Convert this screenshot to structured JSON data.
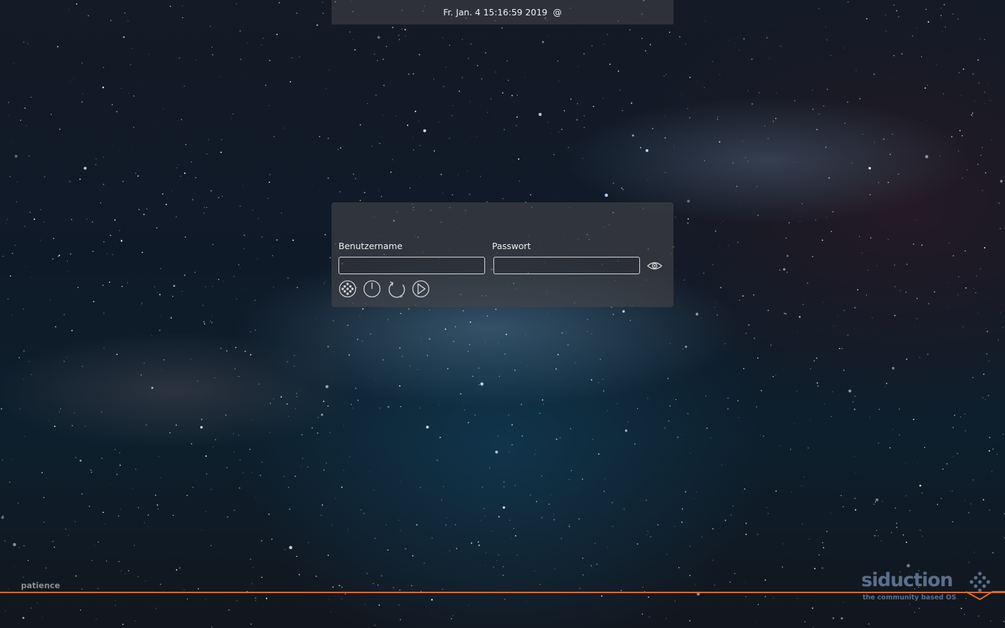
{
  "clock": {
    "datetime": "Fr. Jan. 4 15:16:59 2019",
    "host_suffix": "@"
  },
  "login": {
    "username_label": "Benutzername",
    "password_label": "Passwort",
    "username_value": "",
    "password_value": ""
  },
  "actions": [
    {
      "icon": "session-icon"
    },
    {
      "icon": "power-icon"
    },
    {
      "icon": "restart-icon"
    },
    {
      "icon": "login-arrow-icon"
    }
  ],
  "footer": {
    "status_text": "patience",
    "logo_name": "siduction",
    "logo_tagline": "the community based OS"
  },
  "colors": {
    "accent_line": "#e06d1f",
    "logo": "#5b6f8c",
    "panel": "#464648"
  }
}
